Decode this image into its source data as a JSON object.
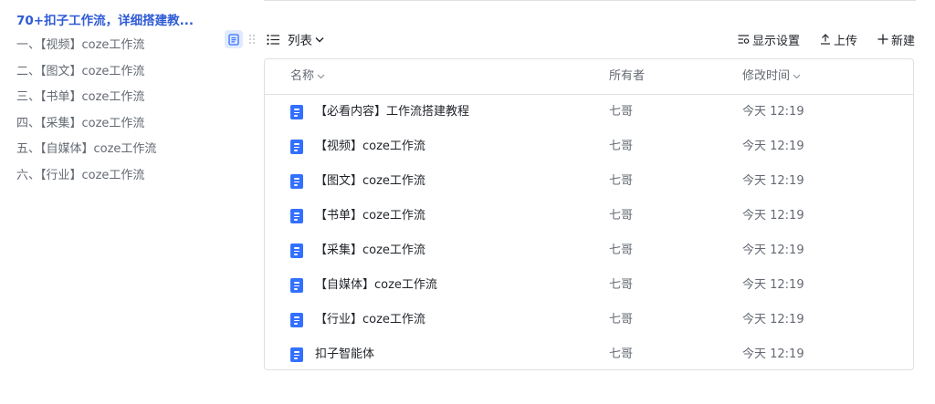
{
  "outline": {
    "title": "70+扣子工作流，详细搭建教...",
    "items": [
      "一、【视频】coze工作流",
      "二、【图文】coze工作流",
      "三、【书单】coze工作流",
      "四、【采集】coze工作流",
      "五、【自媒体】coze工作流",
      "六、【行业】coze工作流"
    ]
  },
  "toolbar": {
    "view_mode_label": "列表",
    "display_settings_label": "显示设置",
    "upload_label": "上传",
    "new_label": "新建"
  },
  "table": {
    "columns": {
      "name": "名称",
      "owner": "所有者",
      "modified": "修改时间"
    },
    "rows": [
      {
        "name": "【必看内容】工作流搭建教程",
        "owner": "七哥",
        "modified": "今天 12:19"
      },
      {
        "name": "【视频】coze工作流",
        "owner": "七哥",
        "modified": "今天 12:19"
      },
      {
        "name": "【图文】coze工作流",
        "owner": "七哥",
        "modified": "今天 12:19"
      },
      {
        "name": "【书单】coze工作流",
        "owner": "七哥",
        "modified": "今天 12:19"
      },
      {
        "name": "【采集】coze工作流",
        "owner": "七哥",
        "modified": "今天 12:19"
      },
      {
        "name": "【自媒体】coze工作流",
        "owner": "七哥",
        "modified": "今天 12:19"
      },
      {
        "name": "【行业】coze工作流",
        "owner": "七哥",
        "modified": "今天 12:19"
      },
      {
        "name": "扣子智能体",
        "owner": "七哥",
        "modified": "今天 12:19"
      }
    ]
  },
  "colors": {
    "accent": "#2f5bd6",
    "doc_icon": "#3370ff",
    "border": "#dee0e3",
    "muted_text": "#646a73"
  },
  "icons": {
    "doc": "doc-icon",
    "list_view": "list-view-icon",
    "grid_view": "grid-view-icon",
    "settings": "display-settings-icon",
    "upload": "upload-icon",
    "new": "plus-icon"
  }
}
